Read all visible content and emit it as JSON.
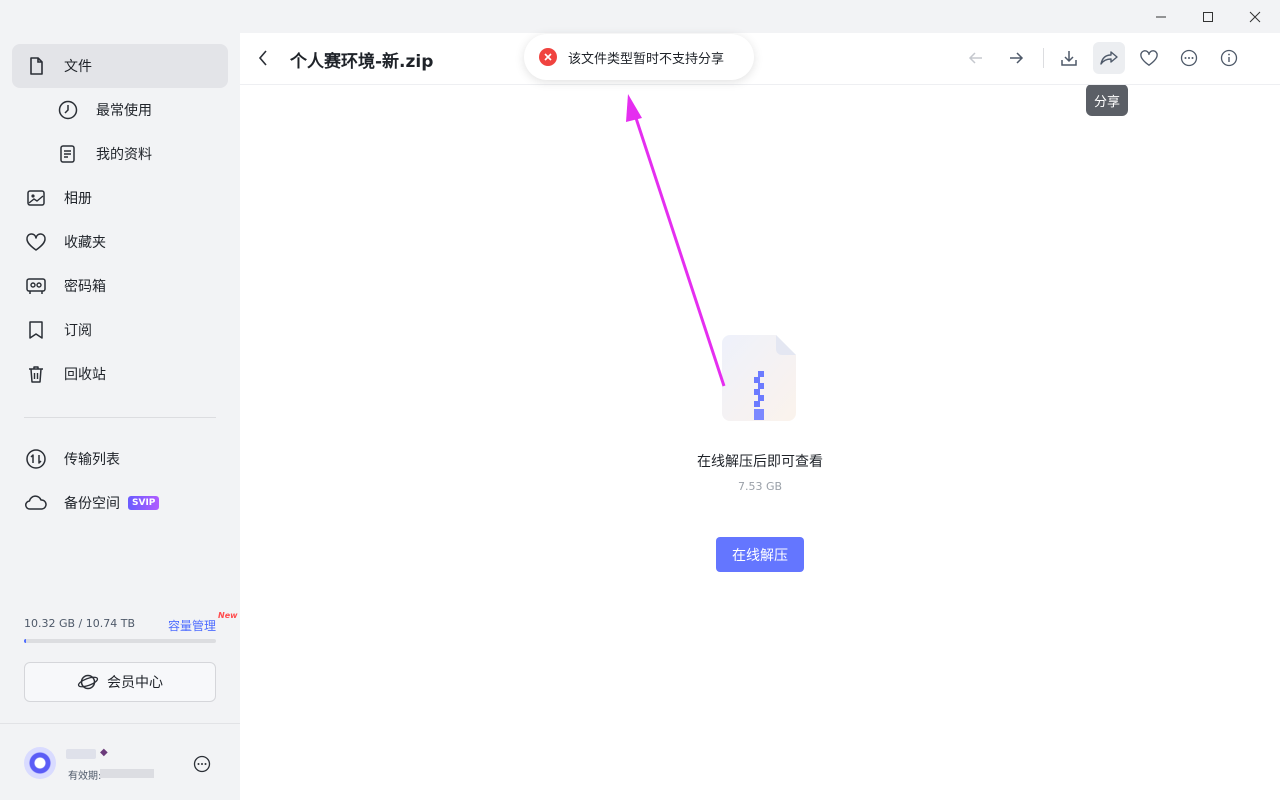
{
  "sidebar": {
    "items": [
      {
        "label": "文件",
        "icon": "file-icon"
      },
      {
        "label": "最常使用",
        "icon": "clock-icon"
      },
      {
        "label": "我的资料",
        "icon": "document-icon"
      },
      {
        "label": "相册",
        "icon": "photo-icon"
      },
      {
        "label": "收藏夹",
        "icon": "heart-icon"
      },
      {
        "label": "密码箱",
        "icon": "safe-icon"
      },
      {
        "label": "订阅",
        "icon": "bookmark-icon"
      },
      {
        "label": "回收站",
        "icon": "trash-icon"
      },
      {
        "label": "传输列表",
        "icon": "transfer-icon"
      },
      {
        "label": "备份空间",
        "icon": "cloud-icon",
        "badge": "SVIP"
      }
    ],
    "storage": {
      "usage_text": "10.32 GB / 10.74 TB",
      "manage_label": "容量管理",
      "new_tag": "New",
      "used_fraction": 0.001
    },
    "member_center_label": "会员中心",
    "profile": {
      "expiry_label": "有效期:"
    }
  },
  "header": {
    "title": "个人赛环境-新.zip",
    "tooltip": "分享"
  },
  "toolbar": {
    "buttons": [
      "arrow-left-icon",
      "arrow-right-icon",
      "download-icon",
      "share-icon",
      "heart-icon",
      "more-icon",
      "info-icon"
    ]
  },
  "toast": {
    "message": "该文件类型暂时不支持分享"
  },
  "main": {
    "hint": "在线解压后即可查看",
    "size": "7.53 GB",
    "extract_button": "在线解压"
  },
  "colors": {
    "accent": "#6476ff",
    "error": "#f0433f",
    "annotation_arrow": "#e52ef0",
    "sidebar_bg": "#f2f3f5"
  }
}
